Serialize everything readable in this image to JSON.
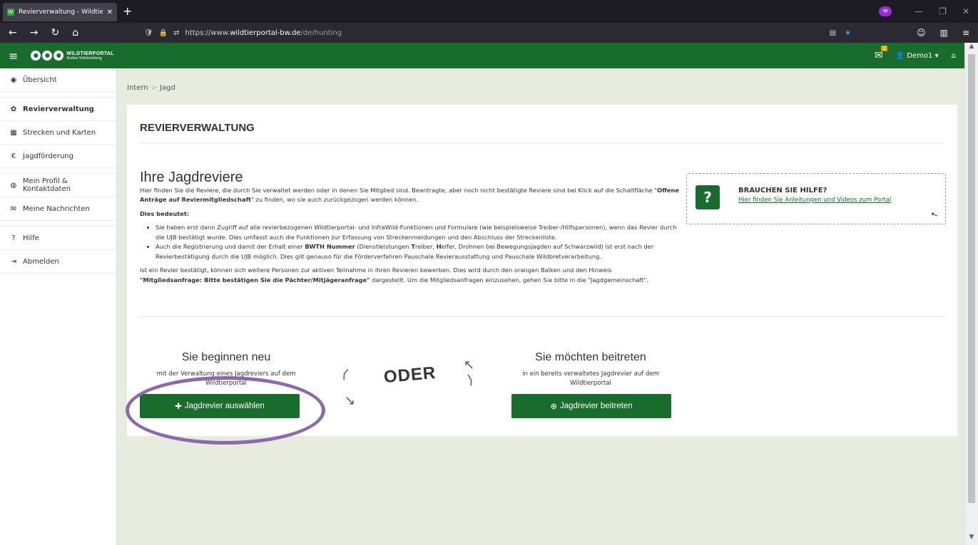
{
  "browser": {
    "tab_title": "Revierverwaltung - Wildtierportal",
    "new_tab": "+",
    "url_prefix": "https://www.",
    "url_domain": "wildtierportal-bw.de",
    "url_path": "/de/hunting"
  },
  "header": {
    "logo_line1": "WILDTIERPORTAL",
    "logo_line2": "Baden-Württemberg",
    "mail_badge": "1",
    "user": "Demo1"
  },
  "sidebar": {
    "items": [
      {
        "label": "Übersicht",
        "icon": "dashboard-icon"
      },
      {
        "label": "Revierverwaltung",
        "icon": "gear-icon"
      },
      {
        "label": "Strecken und Karten",
        "icon": "map-icon"
      },
      {
        "label": "Jagdförderung",
        "icon": "euro-icon"
      },
      {
        "label": "Mein Profil & Kontaktdaten",
        "icon": "user-icon"
      },
      {
        "label": "Meine Nachrichten",
        "icon": "envelope-icon"
      },
      {
        "label": "Hilfe",
        "icon": "question-icon"
      },
      {
        "label": "Abmelden",
        "icon": "logout-icon"
      }
    ]
  },
  "breadcrumb": {
    "first": "Intern",
    "second": "Jagd"
  },
  "panel": {
    "title": "REVIERVERWALTUNG",
    "heading": "Ihre Jagdreviere",
    "intro_a": "Hier finden Sie die Reviere, die durch Sie verwaltet werden oder in denen Sie Mitglied sind. Beantragte, aber noch nicht bestätigte Reviere sind bei Klick auf die Schaltfläche \"",
    "intro_b": "Offene Anträge auf Reviermitgliedschaft",
    "intro_c": "\" zu finden, wo sie auch zurückgezogen werden können.",
    "means": "Dies bedeutet:",
    "bullet1": "Sie haben erst dann Zugriff auf alle revierbezogenen Wildtierportal- und InfraWild-Funktionen und Formulare (wie beispielsweise Treiber-/Hilfspersonen), wenn das Revier durch die UJB bestätigt wurde. Dies umfasst auch die Funktionen zur Erfassung von Streckenmeldungen und den Abschluss der Streckenliste.",
    "bullet2_a": "Auch die Registrierung und damit der Erhalt einer ",
    "bullet2_b": "BWTH Nummer",
    "bullet2_c": " (Dienstleistungen ",
    "bullet2_d": "T",
    "bullet2_e": "reiber, ",
    "bullet2_f": "H",
    "bullet2_g": "elfer, Drohnen bei Bewegungsjagden auf Schwarzwild) ist erst nach der Revierbestätigung durch die UJB möglich. Dies gilt genauso für die Förderverfahren Pauschale Revierausstattung und Pauschale Wildbretverarbeitung.",
    "outro_a": "Ist ein Revier bestätigt, können sich weitere Personen zur aktiven Teilnahme in Ihren Revieren bewerben. Dies wird durch den orangen Balken und den Hinweis",
    "outro_b": "\"Mitgliedsanfrage: Bitte bestätigen Sie die Pächter/Mitjägeranfrage\"",
    "outro_c": " dargestellt. Um die Mitgliedsanfragen einzusehen, gehen Sie bitte in die \"Jagdgemeinschaft\"."
  },
  "help": {
    "title": "BRAUCHEN SIE HILFE?",
    "link": "Hier finden Sie Anleitungen und Videos zum Portal"
  },
  "option_new": {
    "title": "Sie beginnen neu",
    "desc_a": "mit der Verwaltung eines Jagdreviers auf dem",
    "desc_b": "Wildtierportal",
    "button": "Jagdrevier auswählen"
  },
  "option_join": {
    "title": "Sie möchten beitreten",
    "desc_a": "in ein bereits verwaltetes Jagdrevier auf dem",
    "desc_b": "Wildtierportal",
    "button": "Jagdrevier beitreten"
  },
  "oder": "ODER",
  "colors": {
    "brand_green": "#196d2c",
    "highlight_purple": "#8b6aab",
    "page_bg": "#e7ecdf"
  }
}
